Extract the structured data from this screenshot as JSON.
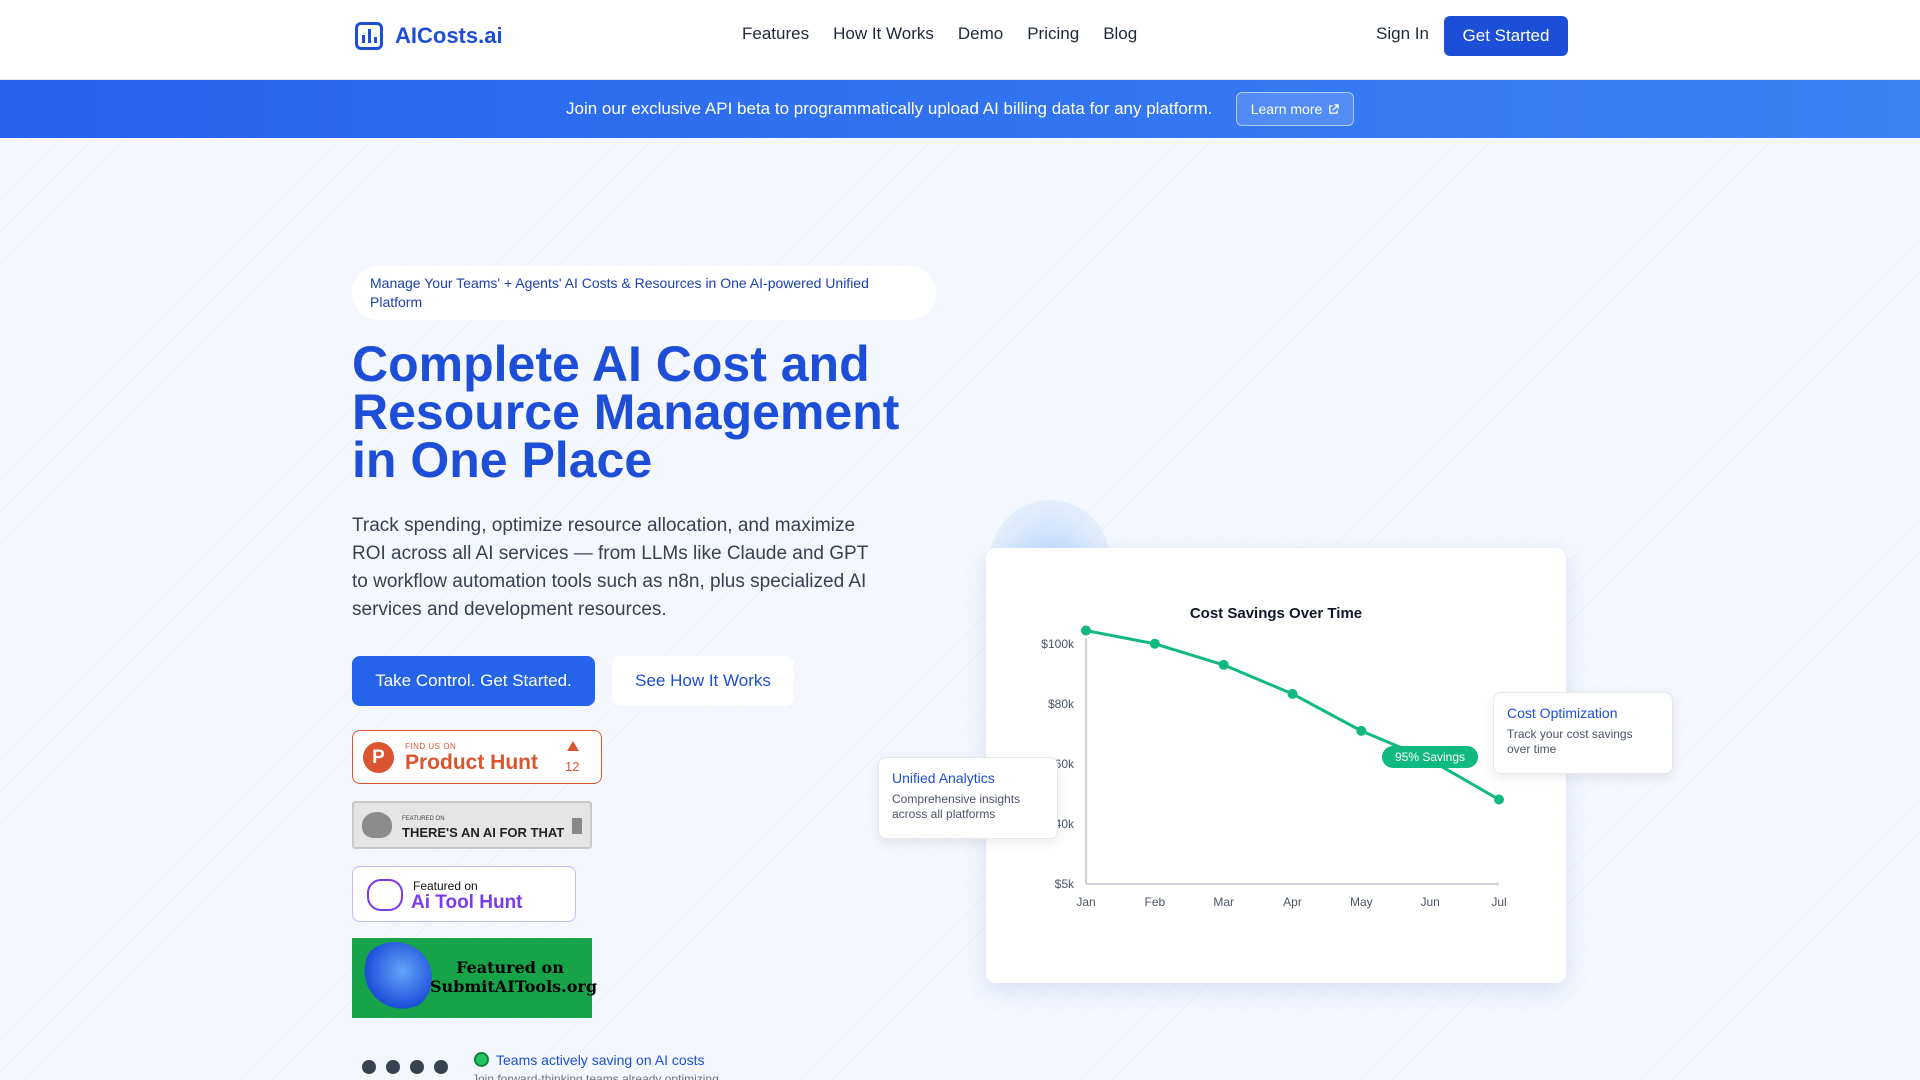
{
  "nav": {
    "logo": "AICosts.ai",
    "links": [
      "Features",
      "How It Works",
      "Demo",
      "Pricing",
      "Blog"
    ],
    "sign_in": "Sign In",
    "get_started": "Get Started"
  },
  "banner": {
    "text": "Join our exclusive API beta to programmatically upload AI billing data for any platform.",
    "learn_more": "Learn more"
  },
  "hero": {
    "pill": "Manage Your Teams' + Agents' AI Costs & Resources in One AI-powered Unified Platform",
    "headline": "Complete AI Cost and Resource Management in One Place",
    "subtext": "Track spending, optimize resource allocation, and maximize ROI across all AI services — from LLMs like Claude and GPT to workflow automation tools such as n8n, plus specialized AI services and development resources.",
    "cta_primary": "Take Control. Get Started.",
    "cta_secondary": "See How It Works"
  },
  "badges": {
    "product_hunt": {
      "small": "FIND US ON",
      "big": "Product Hunt",
      "count": "12"
    },
    "taaft": {
      "small": "FEATURED ON",
      "big": "THERE'S AN AI FOR THAT"
    },
    "ai_tool_hunt": {
      "small": "Featured on",
      "big": "Ai Tool Hunt"
    },
    "submit_ai_tools": {
      "text": "Featured on SubmitAITools.org"
    }
  },
  "teams": {
    "title": "Teams actively saving on AI costs",
    "subtitle": "Join forward-thinking teams already optimizing"
  },
  "colors": {
    "brand": "#1d4ed8",
    "accent_green": "#10b981",
    "banner": "#2563eb"
  },
  "chart_data": {
    "type": "line",
    "title": "Cost Savings Over Time",
    "xlabel": "",
    "ylabel": "",
    "categories": [
      "Jan",
      "Feb",
      "Mar",
      "Apr",
      "May",
      "Jun",
      "Jul"
    ],
    "y_ticks": [
      "$100k",
      "$80k",
      "$60k",
      "$40k",
      "$5k"
    ],
    "series": [
      {
        "values": [
          96,
          91,
          83,
          72,
          58,
          47,
          32
        ],
        "color": "#10b981"
      }
    ],
    "annotation": "95% Savings",
    "grid": false
  },
  "floating_cards": {
    "unified": {
      "title": "Unified Analytics",
      "desc": "Comprehensive insights across all platforms"
    },
    "cost_optimization": {
      "title": "Cost Optimization",
      "desc": "Track your cost savings over time"
    }
  }
}
